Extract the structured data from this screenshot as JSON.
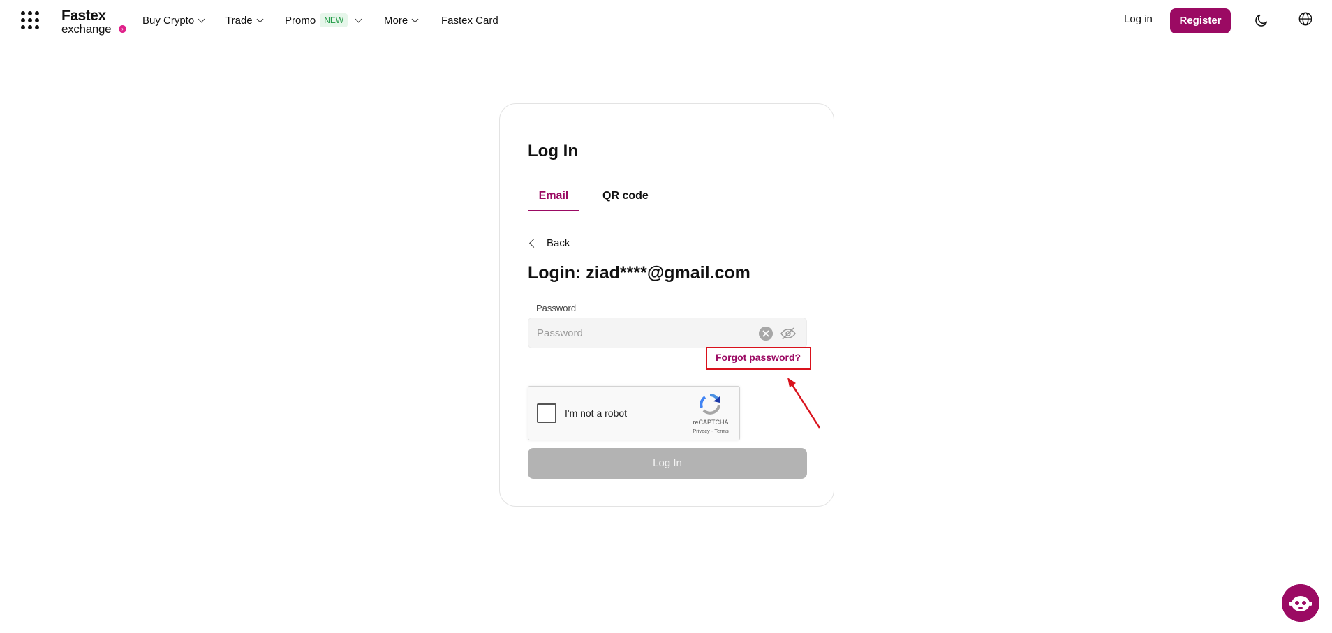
{
  "header": {
    "logo_line1": "Fastex",
    "logo_line2": "exchange",
    "nav": {
      "buy_crypto": "Buy Crypto",
      "trade": "Trade",
      "promo": "Promo",
      "promo_badge": "NEW",
      "more": "More",
      "fastex_card": "Fastex Card"
    },
    "login_label": "Log in",
    "register_label": "Register"
  },
  "login_card": {
    "title": "Log In",
    "tabs": {
      "email": "Email",
      "qr": "QR code"
    },
    "back_label": "Back",
    "login_email": "Login: ziad****@gmail.com",
    "password_label": "Password",
    "password_placeholder": "Password",
    "password_value": "",
    "forgot_password": "Forgot password?",
    "captcha": {
      "text": "I'm not a robot",
      "brand": "reCAPTCHA",
      "links": "Privacy - Terms"
    },
    "submit_label": "Log In"
  },
  "colors": {
    "accent": "#9b0a63",
    "annotation": "#d9121c",
    "disabled_button": "#b3b3b3"
  }
}
